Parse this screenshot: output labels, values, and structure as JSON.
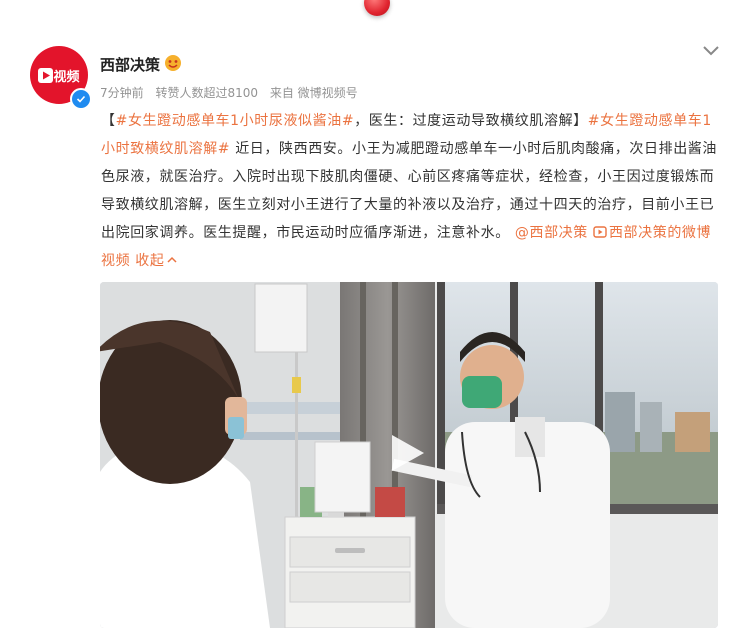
{
  "header": {
    "avatar_text": "视频",
    "user_name": "西部决策",
    "time": "7分钟前",
    "reposts": "转赞人数超过8100",
    "source": "来自 微博视频号"
  },
  "post": {
    "bracket_open": "【",
    "topic1": "#女生蹬动感单车1小时尿液似酱油#",
    "headline_rest": "，医生：过度运动导致横纹肌溶解】",
    "topic2": "#女生蹬动感单车1小时致横纹肌溶解#",
    "body": " 近日，陕西西安。小王为减肥蹬动感单车一小时后肌肉酸痛，次日排出酱油色尿液，就医治疗。入院时出现下肢肌肉僵硬、心前区疼痛等症状，经检查，小王因过度锻炼而导致横纹肌溶解，医生立刻对小王进行了大量的补液以及治疗，通过十四天的治疗，目前小王已出院回家调养。医生提醒，市民运动时应循序渐进，注意补水。",
    "mention": "@西部决策",
    "video_link": "西部决策的微博视频",
    "collapse": "收起"
  },
  "icons": {
    "top_badge": "red-notification-ball",
    "chevron": "chevron-down-icon",
    "verified": "verified-badge-icon",
    "vip": "vip-emoji-icon",
    "video_link_icon": "video-link-icon",
    "collapse_icon": "chevron-up-icon",
    "play": "play-icon"
  },
  "colors": {
    "brand_red": "#e3142b",
    "link_orange": "#eb7340",
    "meta_gray": "#939393",
    "verified_blue": "#1f8bf0"
  }
}
